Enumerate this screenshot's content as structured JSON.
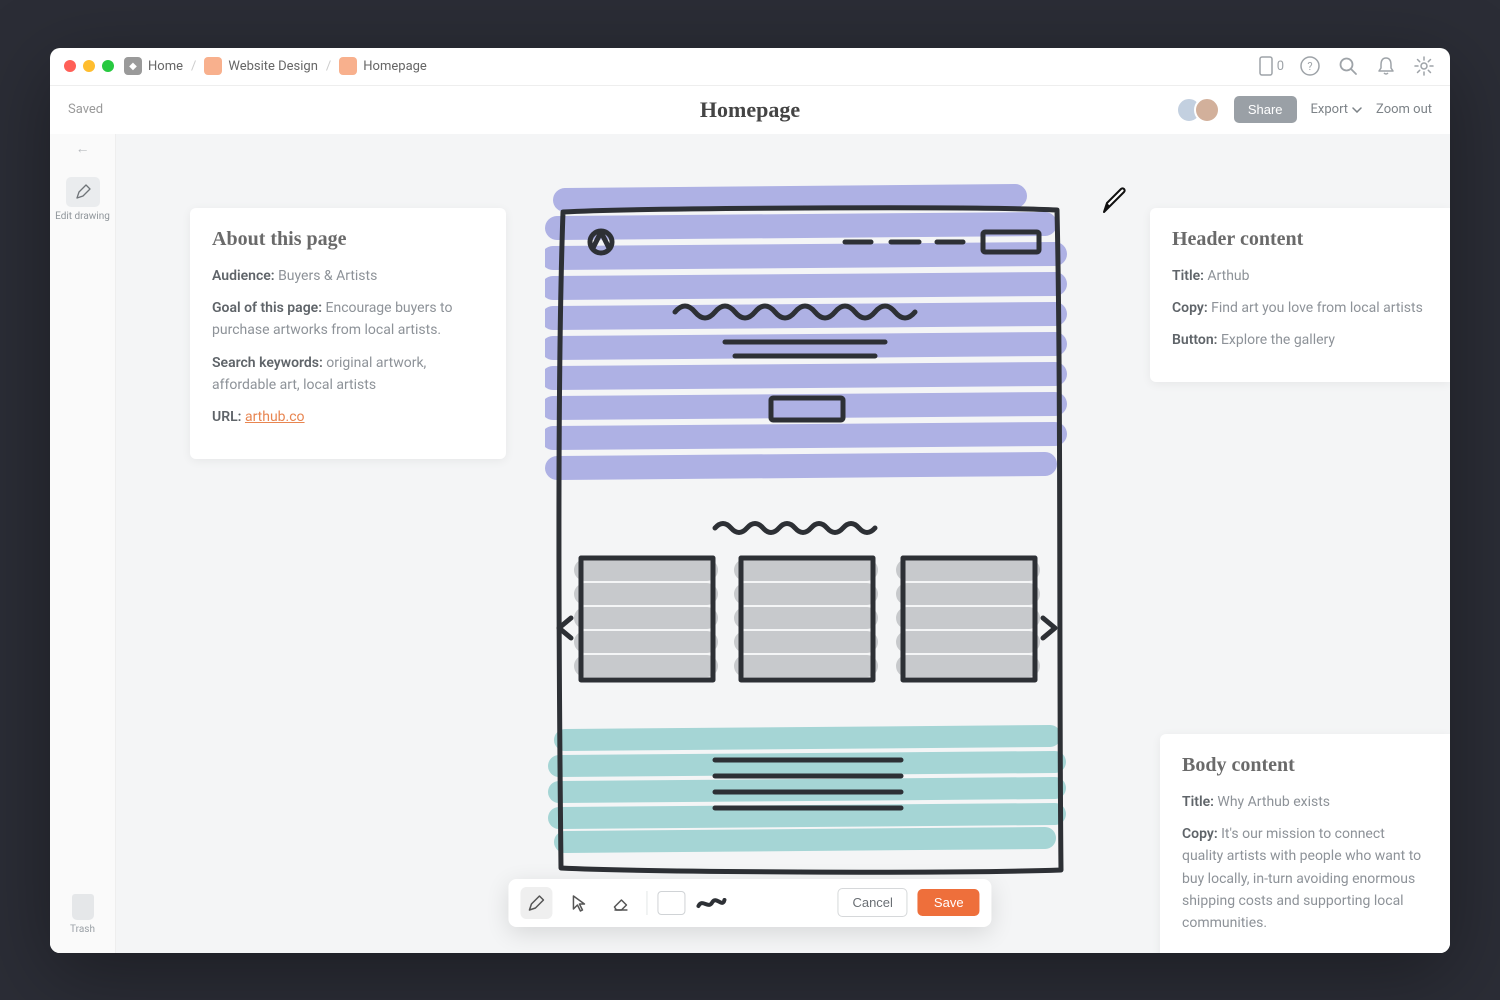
{
  "breadcrumb": {
    "home": "Home",
    "project": "Website Design",
    "page": "Homepage"
  },
  "titlebar": {
    "device_count": "0"
  },
  "subheader": {
    "saved": "Saved",
    "title": "Homepage",
    "share": "Share",
    "export": "Export",
    "zoom_out": "Zoom out"
  },
  "left_rail": {
    "edit_drawing": "Edit drawing",
    "trash": "Trash"
  },
  "about_card": {
    "heading": "About this page",
    "audience_label": "Audience:",
    "audience_value": " Buyers & Artists",
    "goal_label": "Goal of this page:",
    "goal_value": " Encourage buyers to purchase artworks from local artists.",
    "keywords_label": "Search keywords:",
    "keywords_value": " original artwork, affordable art, local artists",
    "url_label": "URL:",
    "url_value": "arthub.co"
  },
  "header_card": {
    "heading": "Header content",
    "title_label": "Title:",
    "title_value": " Arthub",
    "copy_label": "Copy:",
    "copy_value": " Find art you love from local artists",
    "button_label": "Button:",
    "button_value": " Explore the gallery"
  },
  "body_card": {
    "heading": "Body content",
    "title_label": "Title:",
    "title_value": " Why Arthub exists",
    "copy_label": "Copy:",
    "copy_value": " It's our mission to connect quality artists with people who want to buy locally, in-turn avoiding enormous shipping costs and supporting local communities."
  },
  "toolbar": {
    "cancel": "Cancel",
    "save": "Save"
  }
}
